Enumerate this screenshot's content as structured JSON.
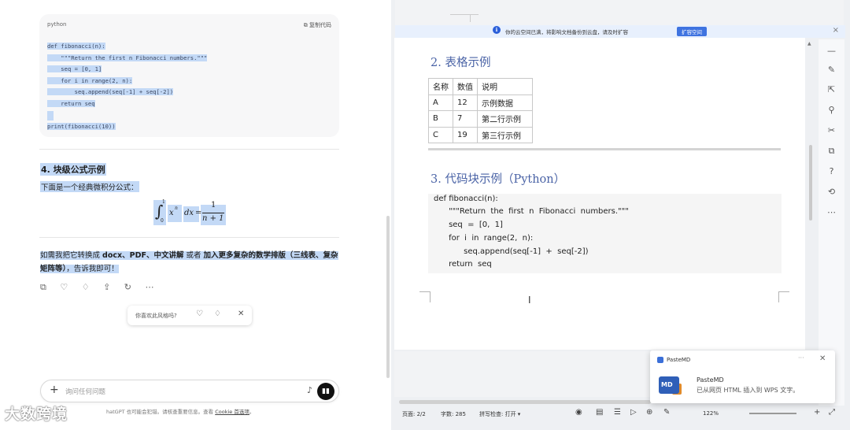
{
  "chat": {
    "code_block": {
      "language": "python",
      "copy_label": "复制代码",
      "lines": [
        "def fibonacci(n):",
        "    \"\"\"Return the first n Fibonacci numbers.\"\"\"",
        "    seq = [0, 1]",
        "    for i in range(2, n):",
        "        seq.append(seq[-1] + seq[-2])",
        "    return seq",
        "",
        "print(fibonacci(10))"
      ]
    },
    "section_heading": "4. 块级公式示例",
    "section_intro": "下面是一个经典微积分公式：",
    "formula": {
      "integral": "∫",
      "lower": "0",
      "upper": "1",
      "base": "x",
      "exp": "n",
      "dx": "dx",
      "equals": "=",
      "numerator": "1",
      "denominator": "n + 1"
    },
    "closing": {
      "part1": "如需我把它转换成 ",
      "bold1": "docx、PDF、中文讲解",
      "part2": " 或者 ",
      "bold2": "加入更多复杂的数学排版（三线表、复杂矩阵等）",
      "part3": "，告诉我即可！"
    },
    "action_icons": [
      "copy-icon",
      "thumbs-up-icon",
      "thumbs-down-icon",
      "share-icon",
      "regenerate-icon",
      "more-icon"
    ],
    "action_glyphs": "⧉ ♡ ♢ ⇪ ↻ ⋯",
    "feedback": {
      "question": "你喜欢此风格吗?",
      "like": "👍",
      "dislike": "👎",
      "close": "✕"
    },
    "composer": {
      "plus": "+",
      "placeholder": "询问任何问题",
      "mic": "🎙",
      "voice": "▮▮▮"
    },
    "disclaimer": {
      "text": "hatGPT 也可能会犯错。请核查重要信息。查看 ",
      "link": "Cookie 首选项",
      "end": "。"
    },
    "watermark": "大数跨境"
  },
  "editor": {
    "notice": {
      "icon": "ℹ",
      "text": "你的云空间已满，将影响文档备份到云盘，请及时扩容",
      "button": "扩容空间",
      "close": "×"
    },
    "section2_title": "2. 表格示例",
    "table": {
      "headers": [
        "名称",
        "数值",
        "说明"
      ],
      "rows": [
        [
          "A",
          "12",
          "示例数据"
        ],
        [
          "B",
          "7",
          "第二行示例"
        ],
        [
          "C",
          "19",
          "第三行示例"
        ]
      ]
    },
    "section3_title": "3. 代码块示例（Python）",
    "code_lines": [
      "def fibonacci(n):",
      "      \"\"\"Return  the  first  n  Fibonacci  numbers.\"\"\"",
      "      seq  =  [0,  1]",
      "      for  i  in  range(2,  n):",
      "            seq.append(seq[-1]  +  seq[-2])",
      "      return  seq"
    ],
    "text_cursor": "I",
    "sidebar_icons": [
      "—",
      "✎",
      "⇱",
      "⚲",
      "✂",
      "⧉",
      "?",
      "⟲",
      "⋯"
    ],
    "status": {
      "page": "页面: 2/2",
      "words": "字数: 285",
      "spell": "拼写检查: 打开 ▾",
      "zoom": "122%"
    },
    "toast": {
      "app": "PasteMD",
      "more": "···",
      "close": "✕",
      "logo": "MD",
      "name": "PasteMD",
      "message": "已从网页 HTML 插入到 WPS 文字。"
    }
  }
}
